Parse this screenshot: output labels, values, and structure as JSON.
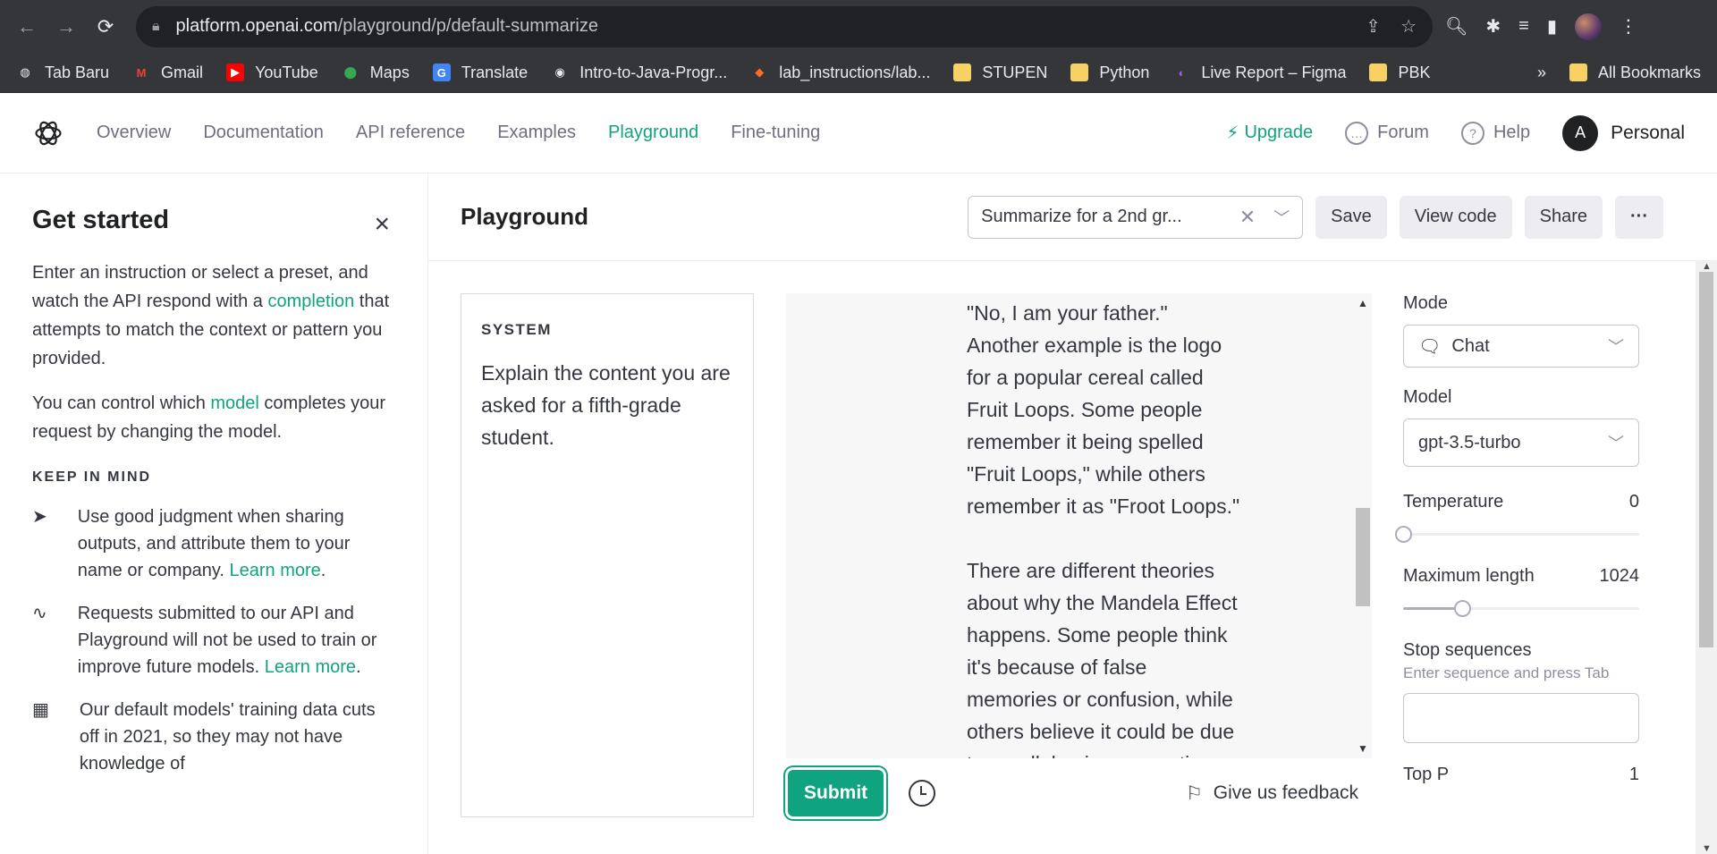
{
  "browser": {
    "url_host": "platform.openai.com",
    "url_path": "/playground/p/default-summarize",
    "bookmarks": [
      {
        "label": "Tab Baru",
        "icon": "globe-icon"
      },
      {
        "label": "Gmail",
        "icon": "gmail-icon"
      },
      {
        "label": "YouTube",
        "icon": "youtube-icon"
      },
      {
        "label": "Maps",
        "icon": "maps-icon"
      },
      {
        "label": "Translate",
        "icon": "translate-icon"
      },
      {
        "label": "Intro-to-Java-Progr...",
        "icon": "github-icon"
      },
      {
        "label": "lab_instructions/lab...",
        "icon": "gitlab-icon"
      },
      {
        "label": "STUPEN",
        "icon": "folder-icon"
      },
      {
        "label": "Python",
        "icon": "folder-icon"
      },
      {
        "label": "Live Report – Figma",
        "icon": "figma-icon"
      },
      {
        "label": "PBK",
        "icon": "folder-icon"
      }
    ],
    "more_bookmarks": "»",
    "all_bookmarks": "All Bookmarks"
  },
  "header": {
    "nav": [
      "Overview",
      "Documentation",
      "API reference",
      "Examples",
      "Playground",
      "Fine-tuning"
    ],
    "active_nav": "Playground",
    "upgrade": "Upgrade",
    "forum": "Forum",
    "help": "Help",
    "avatar_letter": "A",
    "account": "Personal"
  },
  "sidebar": {
    "title": "Get started",
    "p1_before": "Enter an instruction or select a preset, and watch the API respond with a ",
    "p1_link": "completion",
    "p1_after": " that attempts to match the context or pattern you provided.",
    "p2_before": "You can control which ",
    "p2_link": "model",
    "p2_after": " completes your request by changing the model.",
    "keep_in_mind": "KEEP IN MIND",
    "tip1": "Use good judgment when sharing outputs, and attribute them to your name or company. ",
    "tip1_link": "Learn more",
    "tip2": "Requests submitted to our API and Playground will not be used to train or improve future models. ",
    "tip2_link": "Learn more",
    "tip3": "Our default models' training data cuts off in 2021, so they may not have knowledge of"
  },
  "playground": {
    "title": "Playground",
    "preset": "Summarize for a 2nd gr...",
    "save": "Save",
    "view_code": "View code",
    "share": "Share",
    "more": "···",
    "system_label": "SYSTEM",
    "system_text": "Explain the content you are asked for a fifth-grade student.",
    "chat_lines": [
      "\"No, I am your father.\"",
      "Another example is the logo",
      "for a popular cereal called",
      "Fruit Loops. Some people",
      "remember it being spelled",
      "\"Fruit Loops,\" while others",
      "remember it as \"Froot Loops.\"",
      "",
      "There are different theories",
      "about why the Mandela Effect",
      "happens. Some people think",
      "it's because of false",
      "memories or confusion, while",
      "others believe it could be due",
      "to parallel universes or time"
    ],
    "submit": "Submit",
    "feedback": "Give us feedback"
  },
  "settings": {
    "mode_label": "Mode",
    "mode_value": "Chat",
    "model_label": "Model",
    "model_value": "gpt-3.5-turbo",
    "temperature_label": "Temperature",
    "temperature_value": "0",
    "temperature_fraction": 0,
    "max_length_label": "Maximum length",
    "max_length_value": "1024",
    "max_length_fraction": 0.25,
    "stop_label": "Stop sequences",
    "stop_hint": "Enter sequence and press Tab",
    "top_p_label": "Top P",
    "top_p_value": "1"
  },
  "colors": {
    "accent": "#10a37f",
    "chrome": "#35363a"
  }
}
